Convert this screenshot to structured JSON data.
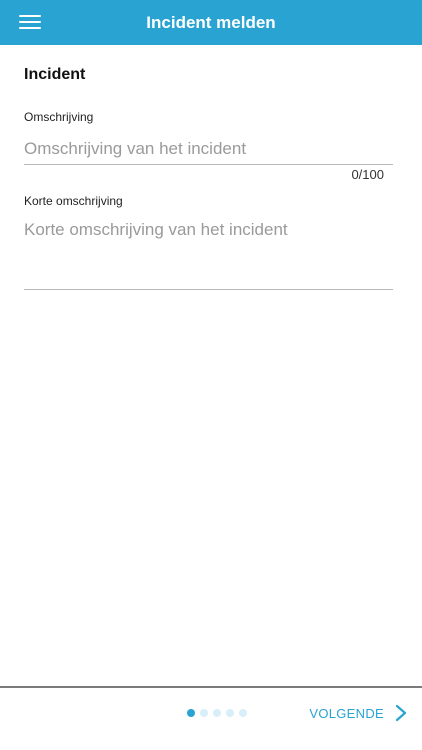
{
  "header": {
    "title": "Incident melden",
    "menu_icon": "hamburger-menu-icon",
    "background_color": "#29a3d2"
  },
  "form": {
    "section_title": "Incident",
    "description": {
      "label": "Omschrijving",
      "value": "",
      "placeholder": "Omschrijving van het incident",
      "counter": "0/100"
    },
    "short_description": {
      "label": "Korte omschrijving",
      "value": "",
      "placeholder": "Korte omschrijving van het incident"
    }
  },
  "footer": {
    "pager": {
      "total": 5,
      "active_index": 0,
      "active_color": "#29a3d2",
      "inactive_color": "#d8eef8"
    },
    "next_label": "VOLGENDE",
    "next_icon": "chevron-right-icon",
    "accent_color": "#29a3d2"
  }
}
